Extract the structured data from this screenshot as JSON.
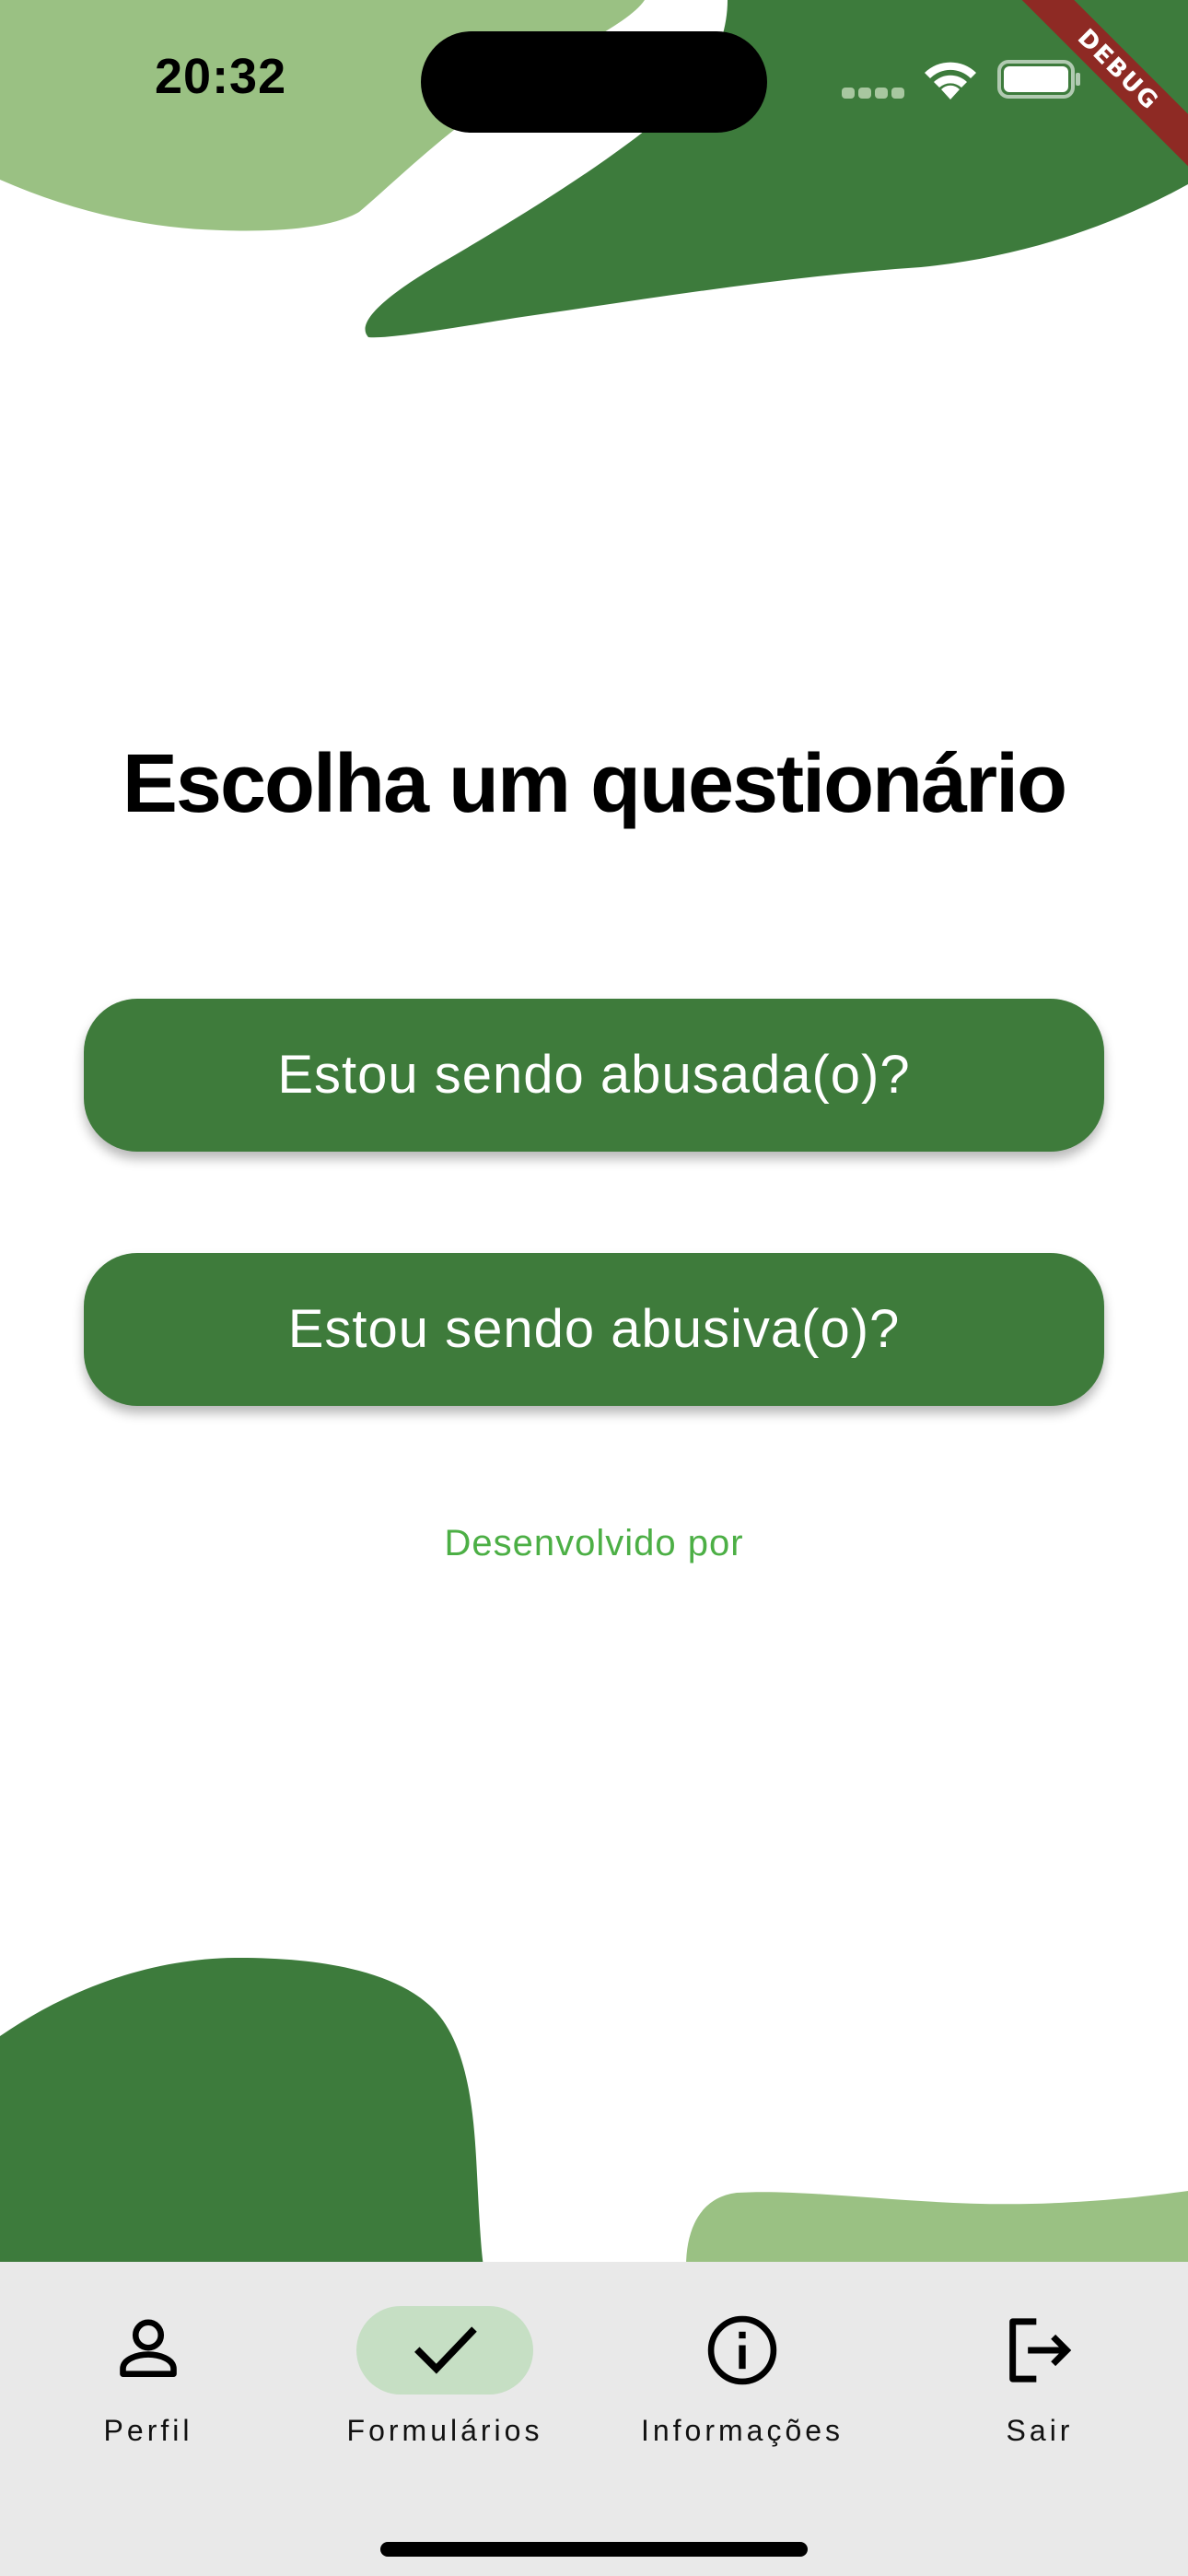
{
  "status_bar": {
    "time": "20:32",
    "debug_label": "DEBUG"
  },
  "main": {
    "title": "Escolha um questionário",
    "buttons": [
      {
        "label": "Estou sendo abusada(o)?"
      },
      {
        "label": "Estou sendo abusiva(o)?"
      }
    ],
    "footer_text": "Desenvolvido por"
  },
  "bottom_nav": {
    "items": [
      {
        "label": "Perfil",
        "icon": "person-icon",
        "active": false
      },
      {
        "label": "Formulários",
        "icon": "check-icon",
        "active": true
      },
      {
        "label": "Informações",
        "icon": "info-icon",
        "active": false
      },
      {
        "label": "Sair",
        "icon": "logout-icon",
        "active": false
      }
    ]
  },
  "colors": {
    "primary_green": "#3e7b3b",
    "light_green": "#9ac183",
    "accent_text_green": "#4caf45",
    "active_nav_pill": "#c6dfc4",
    "nav_background": "#e9e9e9",
    "debug_banner": "#8e2a24"
  }
}
